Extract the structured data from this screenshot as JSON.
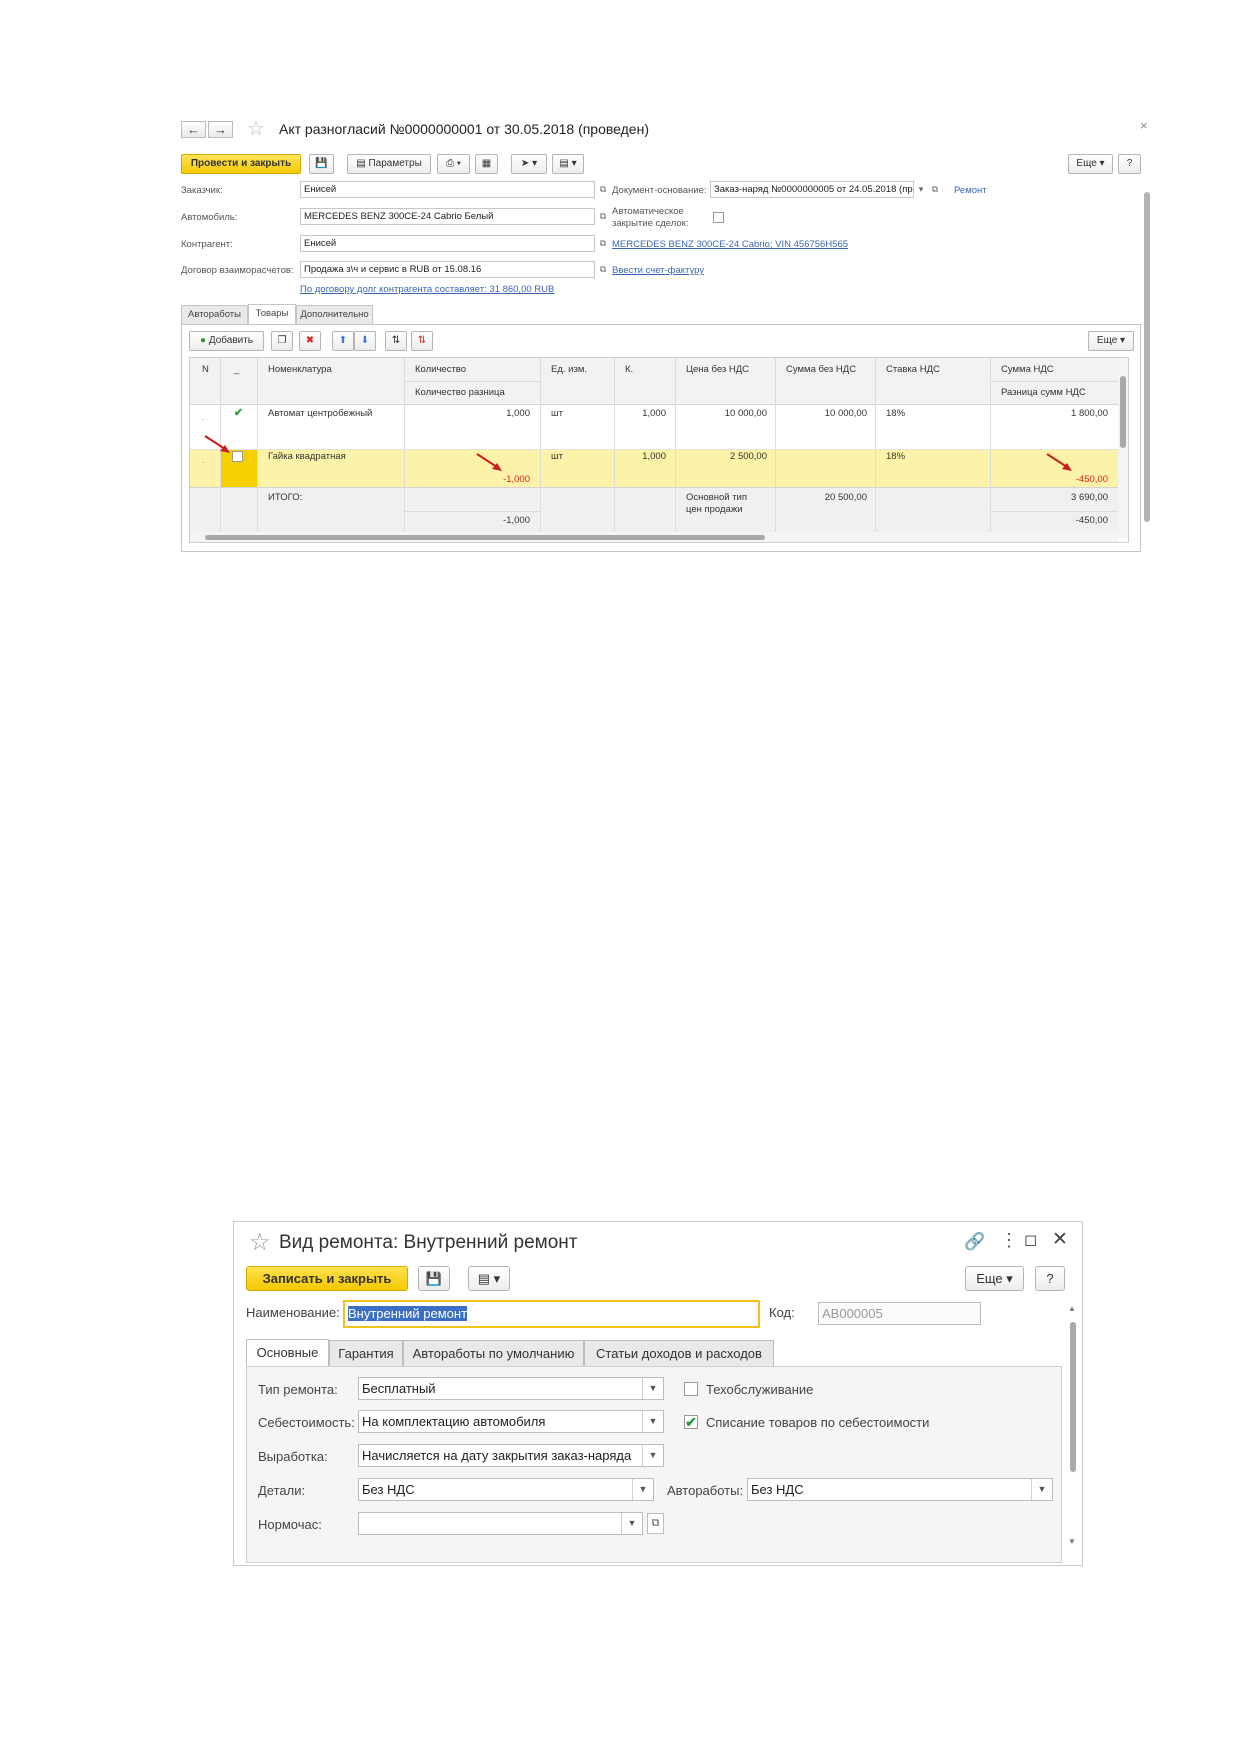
{
  "doc1": {
    "title": "Акт разногласий №0000000001 от 30.05.2018 (проведен)",
    "toolbar": {
      "post_close": "Провести и закрыть",
      "params": "Параметры",
      "more": "Еще",
      "help": "?"
    },
    "fields": {
      "customer_label": "Заказчик:",
      "customer_value": "Енисей",
      "car_label": "Автомобиль:",
      "car_value": "MERCEDES BENZ 300CE-24 Cabrio Белый",
      "counterparty_label": "Контрагент:",
      "counterparty_value": "Енисей",
      "contract_label": "Договор взаиморасчетов:",
      "contract_value": "Продажа з\\ч и сервис в RUB от 15.08.16",
      "debt_link": "По договору долг контрагента составляет: 31 860,00 RUB",
      "basis_label": "Документ-основание:",
      "basis_value": "Заказ-наряд №0000000005 от 24.05.2018 (пр",
      "basis_link": "Ремонт",
      "autoclose_label_1": "Автоматическое",
      "autoclose_label_2": "закрытие сделок:",
      "vin_link": "MERCEDES BENZ 300CE-24 Cabrio; VIN 456756H565",
      "invoice_link": "Ввести счет-фактуру"
    },
    "tabs": [
      "Автоработы",
      "Товары",
      "Дополнительно"
    ],
    "table_toolbar": {
      "add": "Добавить",
      "more": "Еще"
    },
    "columns": {
      "n": "N",
      "mark": "_",
      "nomenclature": "Номенклатура",
      "qty": "Количество",
      "qty_diff": "Количество разница",
      "unit": "Ед. изм.",
      "k": "К.",
      "price": "Цена без НДС",
      "sum": "Сумма без НДС",
      "vat_rate": "Ставка НДС",
      "vat_sum": "Сумма НДС",
      "vat_diff": "Разница сумм НДС"
    },
    "rows": [
      {
        "n": ".",
        "checked": true,
        "name": "Автомат центробежный",
        "qty": "1,000",
        "qty_diff": "",
        "unit": "шт",
        "k": "1,000",
        "price": "10 000,00",
        "sum": "10 000,00",
        "rate": "18%",
        "vat": "1 800,00",
        "vat_diff": ""
      },
      {
        "n": ".",
        "checked": false,
        "name": "Гайка квадратная",
        "qty": "",
        "qty_diff": "-1,000",
        "unit": "шт",
        "k": "1,000",
        "price": "2 500,00",
        "sum": "",
        "rate": "18%",
        "vat": "",
        "vat_diff": "-450,00"
      }
    ],
    "totals": {
      "label": "ИТОГО:",
      "qty_diff": "-1,000",
      "price_type_1": "Основной тип",
      "price_type_2": "цен продажи",
      "sum": "20 500,00",
      "vat": "3 690,00",
      "vat_diff": "-450,00"
    }
  },
  "doc2": {
    "title": "Вид ремонта: Внутренний ремонт",
    "toolbar": {
      "save_close": "Записать и закрыть",
      "more": "Еще",
      "help": "?"
    },
    "name_label": "Наименование:",
    "name_value": "Внутренний ремонт",
    "code_label": "Код:",
    "code_value": "АВ000005",
    "tabs": [
      "Основные",
      "Гарантия",
      "Автоработы по умолчанию",
      "Статьи доходов и расходов"
    ],
    "fields": {
      "repair_type_label": "Тип ремонта:",
      "repair_type_value": "Бесплатный",
      "maintenance_label": "Техобслуживание",
      "cost_label": "Себестоимость:",
      "cost_value": "На комплектацию автомобиля",
      "writeoff_label": "Списание товаров по себестоимости",
      "output_label": "Выработка:",
      "output_value": "Начисляется на дату закрытия заказ-наряда",
      "parts_label": "Детали:",
      "parts_value": "Без НДС",
      "autoworks_label": "Автоработы:",
      "autoworks_value": "Без НДС",
      "normhour_label": "Нормочас:",
      "normhour_value": ""
    },
    "checks": {
      "maintenance": false,
      "writeoff": true
    }
  },
  "colors": {
    "accent_yellow": "#f5c800",
    "row_highlight": "#fdf3a8",
    "link": "#3b66b3",
    "negative": "#e02020"
  }
}
